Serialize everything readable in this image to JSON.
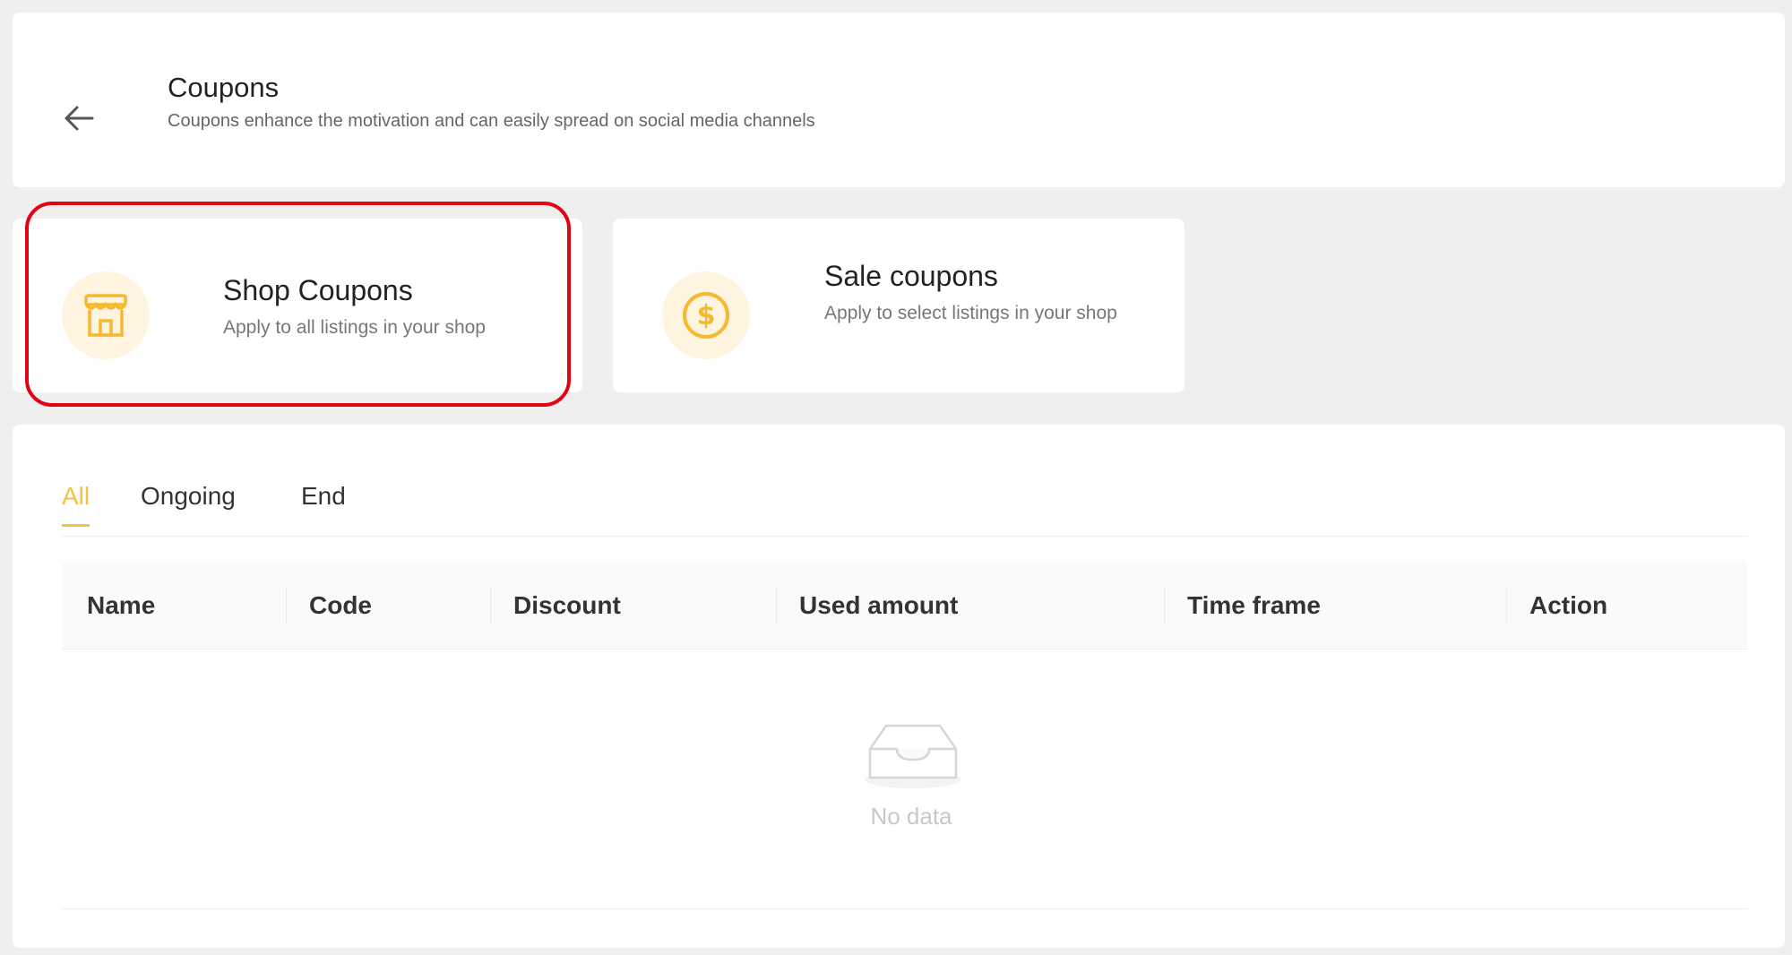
{
  "header": {
    "title": "Coupons",
    "subtitle": "Coupons enhance the motivation and can easily spread on social media channels",
    "back_icon": "arrow-left-icon"
  },
  "cards": [
    {
      "title": "Shop Coupons",
      "description": "Apply to all listings in your shop",
      "icon": "storefront-icon",
      "highlighted": true
    },
    {
      "title": "Sale coupons",
      "description": "Apply to select listings in your shop",
      "icon": "dollar-coin-icon",
      "highlighted": false
    }
  ],
  "tabs": [
    {
      "label": "All",
      "active": true
    },
    {
      "label": "Ongoing",
      "active": false
    },
    {
      "label": "End",
      "active": false
    }
  ],
  "table": {
    "columns": [
      "Name",
      "Code",
      "Discount",
      "Used amount",
      "Time frame",
      "Action"
    ],
    "rows": [],
    "empty_text": "No data",
    "empty_icon": "empty-inbox-icon"
  },
  "colors": {
    "accent": "#f5c342",
    "highlight_border": "#e60012",
    "icon_bg": "#fff4e0"
  }
}
